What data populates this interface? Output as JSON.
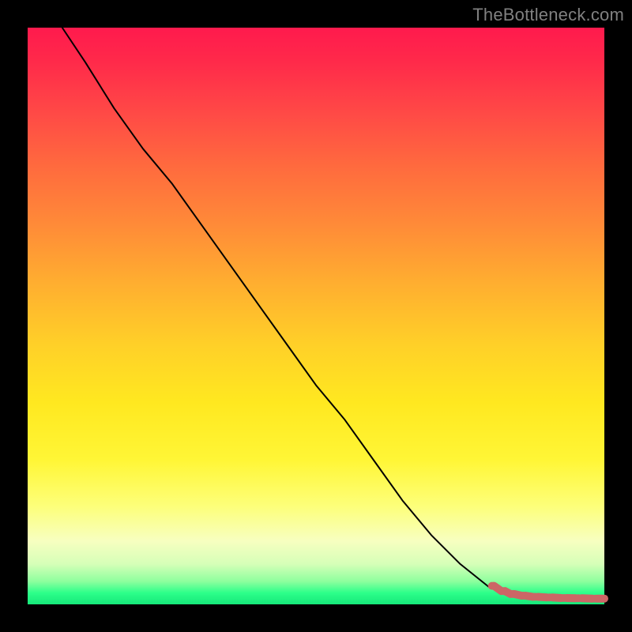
{
  "watermark": "TheBottleneck.com",
  "colors": {
    "page_bg": "#000000",
    "watermark": "#808080",
    "curve": "#000000",
    "marker": "#cc6666"
  },
  "chart_data": {
    "type": "line",
    "title": "",
    "xlabel": "",
    "ylabel": "",
    "xlim": [
      0,
      100
    ],
    "ylim": [
      0,
      100
    ],
    "grid": false,
    "legend": false,
    "series": [
      {
        "name": "bottleneck-curve",
        "x": [
          6,
          10,
          15,
          20,
          25,
          30,
          35,
          40,
          45,
          50,
          55,
          60,
          65,
          70,
          75,
          80,
          82,
          84,
          86,
          88,
          90,
          92,
          94,
          96,
          98,
          100
        ],
        "y": [
          100,
          94,
          86,
          79,
          73,
          66,
          59,
          52,
          45,
          38,
          32,
          25,
          18,
          12,
          7,
          3,
          2.3,
          1.8,
          1.5,
          1.3,
          1.2,
          1.1,
          1.0,
          1.0,
          1.0,
          1.0
        ]
      }
    ],
    "markers": {
      "name": "highlighted-points",
      "color": "#cc6666",
      "points": [
        {
          "x": 80.5,
          "y": 3.2
        },
        {
          "x": 82.5,
          "y": 2.3
        },
        {
          "x": 84.0,
          "y": 1.8
        },
        {
          "x": 86.0,
          "y": 1.5
        },
        {
          "x": 88.0,
          "y": 1.3
        },
        {
          "x": 90.5,
          "y": 1.2
        },
        {
          "x": 93.0,
          "y": 1.1
        },
        {
          "x": 95.5,
          "y": 1.05
        },
        {
          "x": 98.5,
          "y": 1.0
        },
        {
          "x": 100.0,
          "y": 1.0
        }
      ]
    }
  }
}
